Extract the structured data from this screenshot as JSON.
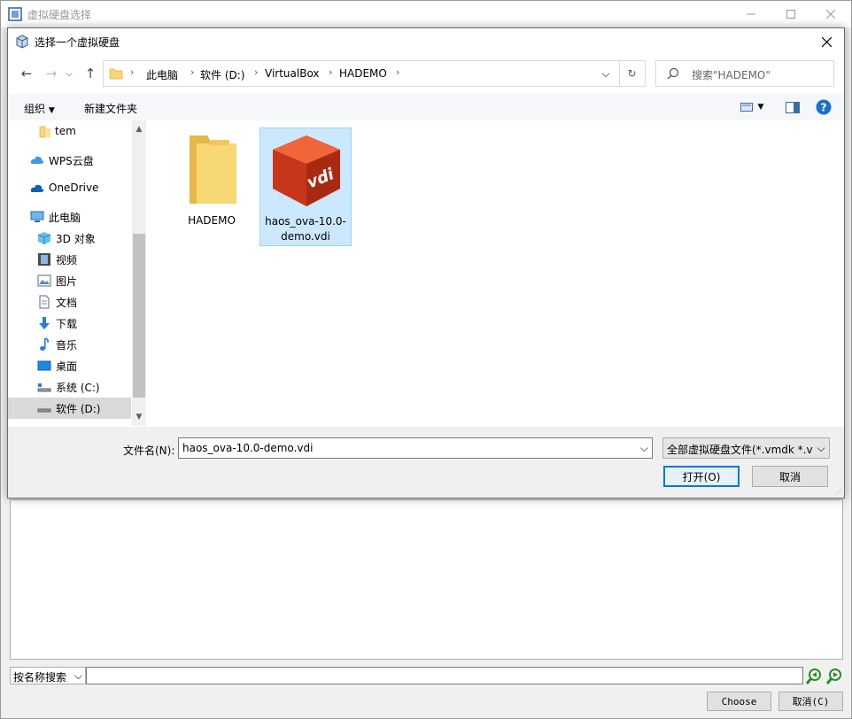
{
  "background_window": {
    "title": "虚拟硬盘选择",
    "search_mode": "按名称搜索",
    "choose_label": "Choose",
    "cancel_label": "取消(C)"
  },
  "dialog": {
    "title": "选择一个虚拟硬盘",
    "breadcrumbs": [
      "此电脑",
      "软件 (D:)",
      "VirtualBox",
      "HADEMO"
    ],
    "search_placeholder": "搜索\"HADEMO\"",
    "toolbar": {
      "organize": "组织",
      "new_folder": "新建文件夹"
    },
    "nav_items": [
      {
        "label": "tem",
        "icon": "folder-icon"
      },
      {
        "label": "WPS云盘",
        "icon": "cloud-icon"
      },
      {
        "label": "OneDrive",
        "icon": "onedrive-icon"
      },
      {
        "label": "此电脑",
        "icon": "computer-icon"
      },
      {
        "label": "3D 对象",
        "icon": "3d-objects-icon"
      },
      {
        "label": "视频",
        "icon": "video-icon"
      },
      {
        "label": "图片",
        "icon": "pictures-icon"
      },
      {
        "label": "文档",
        "icon": "documents-icon"
      },
      {
        "label": "下载",
        "icon": "download-icon"
      },
      {
        "label": "音乐",
        "icon": "music-icon"
      },
      {
        "label": "桌面",
        "icon": "desktop-icon"
      },
      {
        "label": "系统 (C:)",
        "icon": "drive-c-icon"
      },
      {
        "label": "软件 (D:)",
        "icon": "drive-d-icon"
      }
    ],
    "files": [
      {
        "name": "HADEMO",
        "type": "folder"
      },
      {
        "name": "haos_ova-10.0-demo.vdi",
        "name_line1": "haos_ova-10.0-",
        "name_line2": "demo.vdi",
        "type": "vdi"
      }
    ],
    "filename_label": "文件名(N):",
    "filename_value": "haos_ova-10.0-demo.vdi",
    "filetype_value": "全部虚拟硬盘文件(*.vmdk *.vdi *.vhd)",
    "open_label": "打开(O)",
    "cancel_label": "取消"
  },
  "colors": {
    "selection": "#cce8ff",
    "selection_border": "#99d1ff",
    "accent": "#0078d7",
    "folder": "#f8d775",
    "vdi": "#e2461c"
  }
}
